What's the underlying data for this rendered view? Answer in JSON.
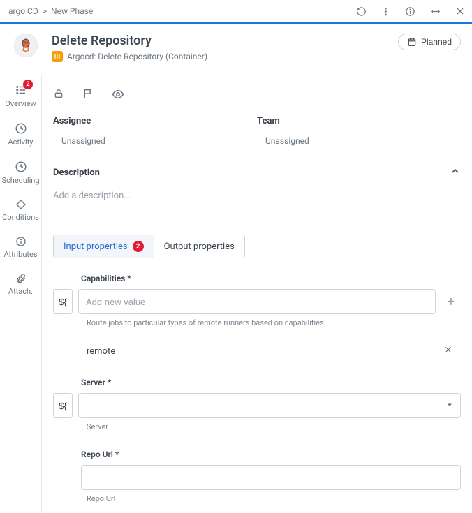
{
  "breadcrumb": {
    "root": "argo CD",
    "sep": ">",
    "phase": "New Phase"
  },
  "header": {
    "title": "Delete Repository",
    "subtitle": "Argocd: Delete Repository (Container)",
    "status_label": "Planned"
  },
  "sidebar": {
    "items": [
      {
        "label": "Overview",
        "badge": "2"
      },
      {
        "label": "Activity"
      },
      {
        "label": "Scheduling"
      },
      {
        "label": "Conditions"
      },
      {
        "label": "Attributes"
      },
      {
        "label": "Attach."
      }
    ]
  },
  "meta": {
    "assignee": {
      "label": "Assignee",
      "value": "Unassigned"
    },
    "team": {
      "label": "Team",
      "value": "Unassigned"
    }
  },
  "description": {
    "label": "Description",
    "placeholder": "Add a description..."
  },
  "tabs": {
    "input": {
      "label": "Input properties",
      "count": "2"
    },
    "output": {
      "label": "Output properties"
    }
  },
  "fields": {
    "var_glyph": "${",
    "capabilities": {
      "label": "Capabilities *",
      "placeholder": "Add new value",
      "helper": "Route jobs to particular types of remote runners based on capabilities",
      "values": [
        "remote"
      ]
    },
    "server": {
      "label": "Server *",
      "helper": "Server",
      "value": ""
    },
    "repo_url": {
      "label": "Repo Url *",
      "helper": "Repo Url",
      "value": ""
    }
  }
}
